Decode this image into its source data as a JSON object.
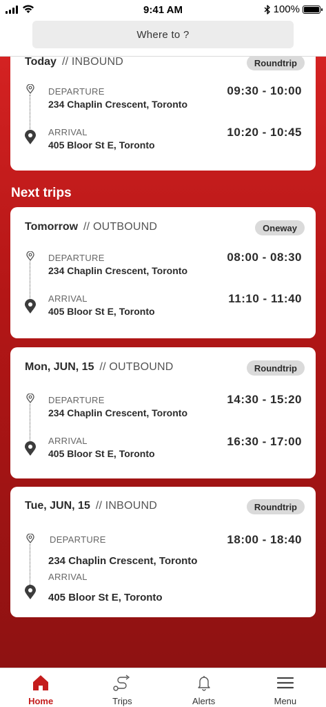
{
  "status_bar": {
    "time": "9:41 AM",
    "battery": "100%"
  },
  "search": {
    "placeholder": "Where to ?"
  },
  "colors": {
    "accent": "#c41c1c",
    "gradient_top": "#d42222",
    "gradient_bottom": "#8e1212",
    "badge": "#dadada"
  },
  "today": {
    "day": "Today",
    "direction": "// INBOUND",
    "badge": "Roundtrip",
    "departure_label": "DEPARTURE",
    "departure_address": "234 Chaplin Crescent, Toronto",
    "departure_time": "09:30 - 10:00",
    "arrival_label": "ARRIVAL",
    "arrival_address": "405 Bloor St E, Toronto",
    "arrival_time": "10:20 - 10:45"
  },
  "next_trips": {
    "title": "Next trips",
    "trips": [
      {
        "day": "Tomorrow",
        "direction": "// OUTBOUND",
        "badge": "Oneway",
        "departure_label": "DEPARTURE",
        "departure_address": "234 Chaplin Crescent, Toronto",
        "departure_time": "08:00 - 08:30",
        "arrival_label": "ARRIVAL",
        "arrival_address": "405 Bloor St E, Toronto",
        "arrival_time": "11:10 - 11:40"
      },
      {
        "day": "Mon, JUN, 15",
        "direction": "// OUTBOUND",
        "badge": "Roundtrip",
        "departure_label": "DEPARTURE",
        "departure_address": "234 Chaplin Crescent, Toronto",
        "departure_time": "14:30 - 15:20",
        "arrival_label": "ARRIVAL",
        "arrival_address": "405 Bloor St E, Toronto",
        "arrival_time": "16:30 - 17:00"
      },
      {
        "day": "Tue, JUN, 15",
        "direction": "// INBOUND",
        "badge": "Roundtrip",
        "departure_label": "DEPARTURE",
        "departure_address": "234 Chaplin Crescent, Toronto",
        "departure_time": "18:00 - 18:40",
        "arrival_label": "ARRIVAL",
        "arrival_address": "405 Bloor St E, Toronto",
        "arrival_time": ""
      }
    ]
  },
  "tabs": [
    {
      "label": "Home",
      "icon": "home-icon",
      "active": true
    },
    {
      "label": "Trips",
      "icon": "route-icon",
      "active": false
    },
    {
      "label": "Alerts",
      "icon": "bell-icon",
      "active": false
    },
    {
      "label": "Menu",
      "icon": "menu-icon",
      "active": false
    }
  ]
}
